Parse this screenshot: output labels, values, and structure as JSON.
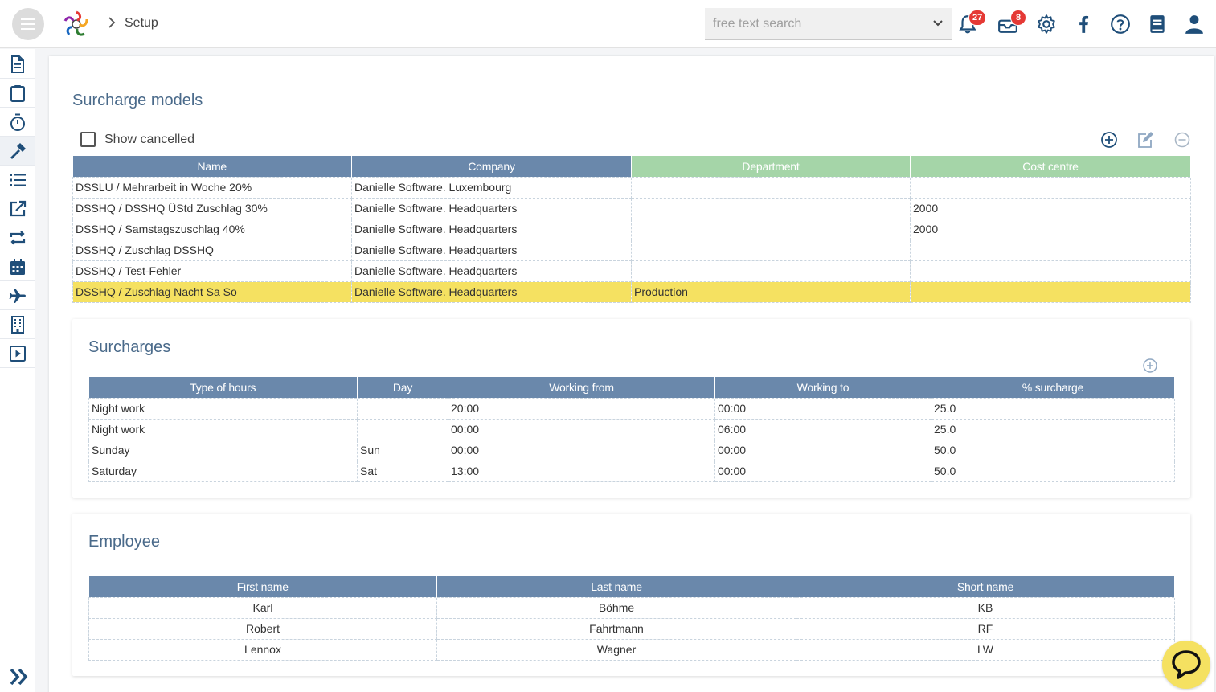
{
  "header": {
    "breadcrumb": "Setup",
    "search_placeholder": "free text search",
    "notifications_count": "27",
    "messages_count": "8"
  },
  "sidebar": {
    "items": [
      "document",
      "clipboard",
      "stopwatch",
      "hammer",
      "list",
      "external-link",
      "repeat",
      "calendar",
      "plane",
      "building",
      "play"
    ],
    "active": "hammer"
  },
  "surcharge_models": {
    "title": "Surcharge models",
    "show_cancelled_label": "Show cancelled",
    "columns": [
      "Name",
      "Company",
      "Department",
      "Cost centre"
    ],
    "rows": [
      {
        "name": "DSSLU / Mehrarbeit in Woche 20%",
        "company": "Danielle Software. Luxembourg",
        "department": "",
        "cost_centre": ""
      },
      {
        "name": "DSSHQ / DSSHQ ÜStd Zuschlag 30%",
        "company": "Danielle Software. Headquarters",
        "department": "",
        "cost_centre": "2000"
      },
      {
        "name": "DSSHQ / Samstagszuschlag 40%",
        "company": "Danielle Software. Headquarters",
        "department": "",
        "cost_centre": "2000"
      },
      {
        "name": "DSSHQ / Zuschlag DSSHQ",
        "company": "Danielle Software. Headquarters",
        "department": "",
        "cost_centre": ""
      },
      {
        "name": "DSSHQ / Test-Fehler",
        "company": "Danielle Software. Headquarters",
        "department": "",
        "cost_centre": ""
      },
      {
        "name": "DSSHQ / Zuschlag Nacht Sa So",
        "company": "Danielle Software. Headquarters",
        "department": "Production",
        "cost_centre": ""
      }
    ]
  },
  "surcharges": {
    "title": "Surcharges",
    "columns": [
      "Type of hours",
      "Day",
      "Working from",
      "Working to",
      "% surcharge"
    ],
    "rows": [
      {
        "type": "Night work",
        "day": "",
        "from": "20:00",
        "to": "00:00",
        "pct": "25.0"
      },
      {
        "type": "Night work",
        "day": "",
        "from": "00:00",
        "to": "06:00",
        "pct": "25.0"
      },
      {
        "type": "Sunday",
        "day": "Sun",
        "from": "00:00",
        "to": "00:00",
        "pct": "50.0"
      },
      {
        "type": "Saturday",
        "day": "Sat",
        "from": "13:00",
        "to": "00:00",
        "pct": "50.0"
      }
    ]
  },
  "employee": {
    "title": "Employee",
    "columns": [
      "First name",
      "Last name",
      "Short name"
    ],
    "rows": [
      {
        "first": "Karl",
        "last": "Böhme",
        "short": "KB"
      },
      {
        "first": "Robert",
        "last": "Fahrtmann",
        "short": "RF"
      },
      {
        "first": "Lennox",
        "last": "Wagner",
        "short": "LW"
      }
    ]
  },
  "colors": {
    "header_blue": "#6a88ab",
    "header_green": "#a5d5a8",
    "selected_row": "#f5e161",
    "icon_blue": "#1f4e79"
  }
}
